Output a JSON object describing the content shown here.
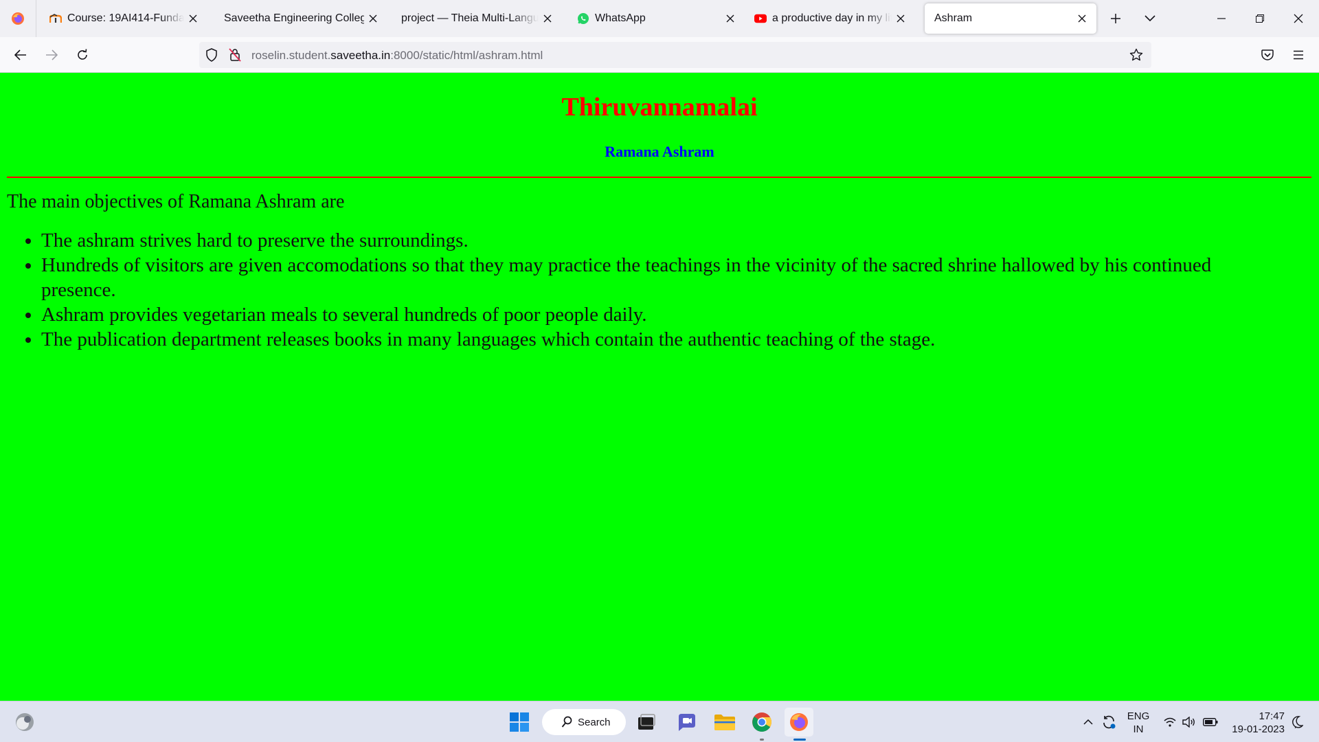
{
  "browser": {
    "tabs": [
      {
        "title": "Course: 19AI414-Fundament",
        "icon": "moodle-icon",
        "active": false
      },
      {
        "title": "Saveetha Engineering College",
        "icon": "none",
        "active": false
      },
      {
        "title": "project — Theia Multi-Language",
        "icon": "none",
        "active": false
      },
      {
        "title": "WhatsApp",
        "icon": "whatsapp-icon",
        "active": false
      },
      {
        "title": "a productive day in my life",
        "icon": "youtube-icon",
        "active": false
      },
      {
        "title": "Ashram",
        "icon": "none",
        "active": true
      }
    ],
    "url": {
      "prefix": "roselin.student.",
      "host": "saveetha.in",
      "suffix": ":8000/static/html/ashram.html"
    }
  },
  "page": {
    "background": "#00ff00",
    "heading": "Thiruvannamalai",
    "heading_color": "#ff0000",
    "subheading": "Ramana Ashram",
    "subheading_color": "#0000ff",
    "rule_color": "#ff0000",
    "intro": "The main objectives of Ramana Ashram are",
    "objectives": [
      "The ashram strives hard to preserve the surroundings.",
      "Hundreds of visitors are given accomodations so that they may practice the teachings in the vicinity of the sacred shrine hallowed by his continued presence.",
      "Ashram provides vegetarian meals to several hundreds of poor people daily.",
      "The publication department releases books in many languages which contain the authentic teaching of the stage."
    ]
  },
  "taskbar": {
    "search_label": "Search",
    "lang_top": "ENG",
    "lang_bottom": "IN",
    "time": "17:47",
    "date": "19-01-2023"
  }
}
